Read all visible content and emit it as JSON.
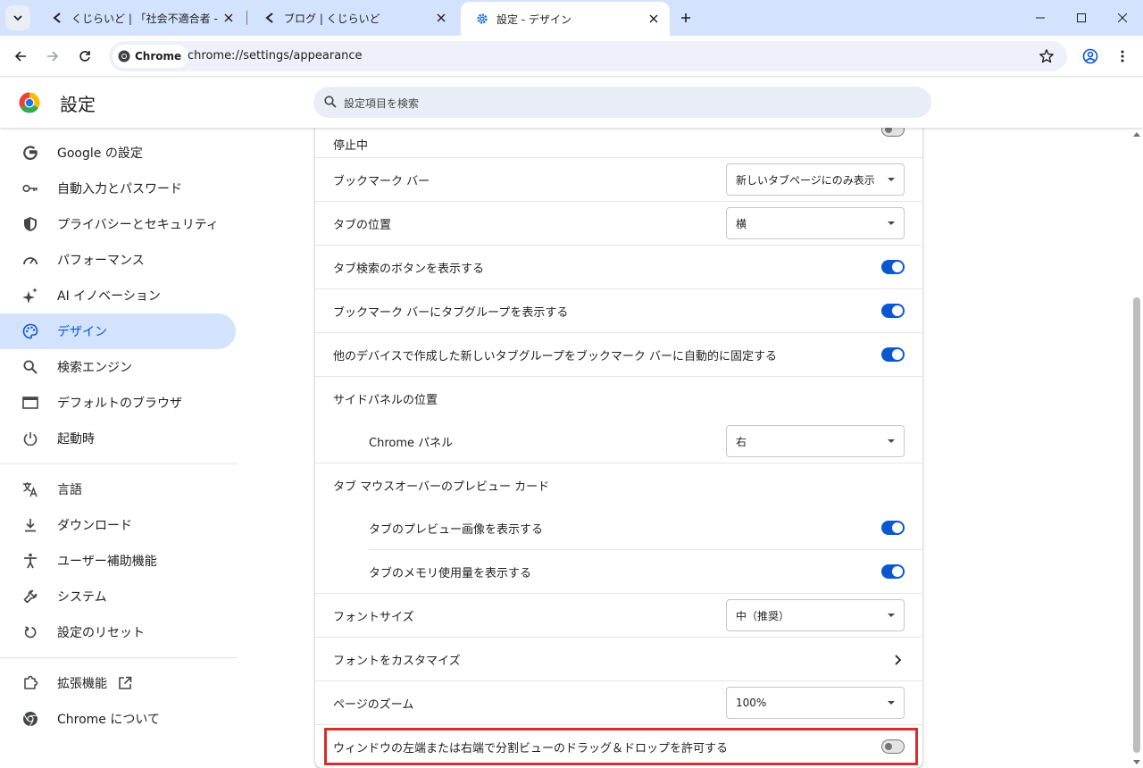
{
  "tabs": [
    {
      "title": "くじらいど | 「社会不適合者 - 人生",
      "active": false
    },
    {
      "title": "ブログ | くじらいど",
      "active": false
    },
    {
      "title": "設定 - デザイン",
      "active": true
    }
  ],
  "toolbar": {
    "chip_label": "Chrome",
    "url": "chrome://settings/appearance"
  },
  "header": {
    "title": "設定",
    "search_placeholder": "設定項目を検索"
  },
  "sidebar": {
    "items": [
      {
        "label": "Google の設定",
        "icon": "google-icon"
      },
      {
        "label": "自動入力とパスワード",
        "icon": "key-icon"
      },
      {
        "label": "プライバシーとセキュリティ",
        "icon": "shield-icon"
      },
      {
        "label": "パフォーマンス",
        "icon": "speedometer-icon"
      },
      {
        "label": "AI イノベーション",
        "icon": "sparkle-icon"
      },
      {
        "label": "デザイン",
        "icon": "palette-icon",
        "selected": true
      },
      {
        "label": "検索エンジン",
        "icon": "search-icon"
      },
      {
        "label": "デフォルトのブラウザ",
        "icon": "browser-window-icon"
      },
      {
        "label": "起動時",
        "icon": "power-icon"
      },
      {
        "label": "言語",
        "icon": "translate-icon"
      },
      {
        "label": "ダウンロード",
        "icon": "download-icon"
      },
      {
        "label": "ユーザー補助機能",
        "icon": "accessibility-icon"
      },
      {
        "label": "システム",
        "icon": "wrench-icon"
      },
      {
        "label": "設定のリセット",
        "icon": "reset-icon"
      },
      {
        "label": "拡張機能",
        "icon": "extension-icon"
      },
      {
        "label": "Chrome について",
        "icon": "chrome-icon"
      }
    ]
  },
  "settings": {
    "partial_row": "停止中",
    "bookmark_bar": {
      "label": "ブックマーク バー",
      "value": "新しいタブページにのみ表示"
    },
    "tab_position": {
      "label": "タブの位置",
      "value": "横"
    },
    "tab_search_button": {
      "label": "タブ検索のボタンを表示する",
      "on": true
    },
    "tab_groups_in_bookmark_bar": {
      "label": "ブックマーク バーにタブグループを表示する",
      "on": true
    },
    "pin_tab_groups": {
      "label": "他のデバイスで作成した新しいタブグループをブックマーク バーに自動的に固定する",
      "on": true
    },
    "side_panel_position": {
      "label": "サイドパネルの位置"
    },
    "chrome_panel": {
      "label": "Chrome パネル",
      "value": "右"
    },
    "hover_card": {
      "label": "タブ マウスオーバーのプレビュー カード"
    },
    "hover_preview_image": {
      "label": "タブのプレビュー画像を表示する",
      "on": true
    },
    "hover_memory_usage": {
      "label": "タブのメモリ使用量を表示する",
      "on": true
    },
    "font_size": {
      "label": "フォントサイズ",
      "value": "中（推奨）"
    },
    "customize_fonts": {
      "label": "フォントをカスタマイズ"
    },
    "page_zoom": {
      "label": "ページのズーム",
      "value": "100%"
    },
    "split_view_drag": {
      "label": "ウィンドウの左端または右端で分割ビューのドラッグ＆ドロップを許可する",
      "on": false
    }
  },
  "colors": {
    "accent": "#0b57d0",
    "selected_nav_bg": "#d3e3fd",
    "highlight_border": "#d32f2f"
  }
}
